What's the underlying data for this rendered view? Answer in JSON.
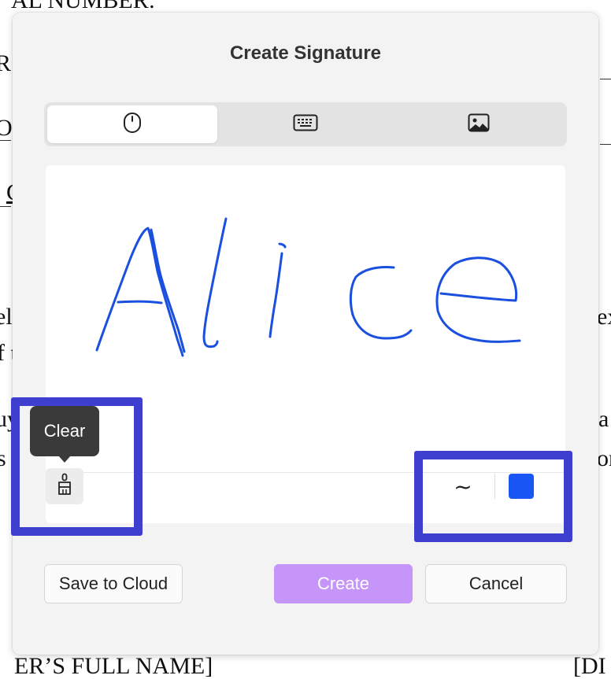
{
  "background_document": {
    "top_fragment": "AL NUMBER:",
    "left_fragments": [
      "R:",
      "OI",
      "C",
      "ell",
      "f t",
      "uy",
      "s c"
    ],
    "right_fragments": [
      "ex",
      "a",
      "or"
    ],
    "bottom_left": "ER’S FULL NAME]",
    "bottom_right": "[DI"
  },
  "dialog": {
    "title": "Create Signature",
    "tabs": [
      {
        "icon": "mouse-icon",
        "active": true
      },
      {
        "icon": "keyboard-icon",
        "active": false
      },
      {
        "icon": "image-icon",
        "active": false
      }
    ],
    "signature_text": "Alice",
    "ink_color": "#1a4fe0",
    "tooltip": "Clear",
    "clear_icon": "brush-icon",
    "stroke_glyph": "~",
    "swatch_color": "#1a56f5",
    "highlight_color": "#3f3fcf",
    "buttons": {
      "save_to_cloud": "Save to Cloud",
      "create": "Create",
      "cancel": "Cancel"
    }
  }
}
